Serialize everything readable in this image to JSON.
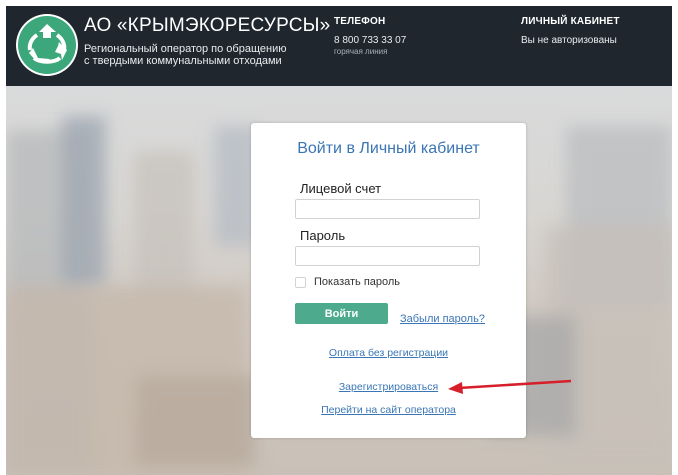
{
  "header": {
    "brand_title": "АО «КРЫМЭКОРЕСУРСЫ»",
    "brand_subtitle_line1": "Региональный оператор по обращению",
    "brand_subtitle_line2": "с твердыми коммунальными отходами",
    "phone": {
      "label": "ТЕЛЕФОН",
      "number": "8 800 733 33 07",
      "note": "горячая линия"
    },
    "cabinet": {
      "label": "ЛИЧНЫЙ КАБИНЕТ",
      "status": "Вы не авторизованы"
    }
  },
  "login": {
    "title": "Войти в Личный кабинет",
    "account_label": "Лицевой счет",
    "account_value": "",
    "password_label": "Пароль",
    "password_value": "",
    "show_password_label": "Показать пароль",
    "login_button": "Войти",
    "forgot_link": "Забыли пароль?",
    "pay_without_registration_link": "Оплата без регистрации",
    "register_link": "Зарегистрироваться",
    "operator_site_link": "Перейти на сайт оператора"
  },
  "colors": {
    "header_bg": "#1f262e",
    "accent_blue": "#3a76b5",
    "button_green": "#4daa8c",
    "logo_green": "#3ba77a",
    "arrow_red": "#d61f2a"
  },
  "icons": {
    "logo": "recycle-icon",
    "pointer": "red-arrow-icon"
  }
}
